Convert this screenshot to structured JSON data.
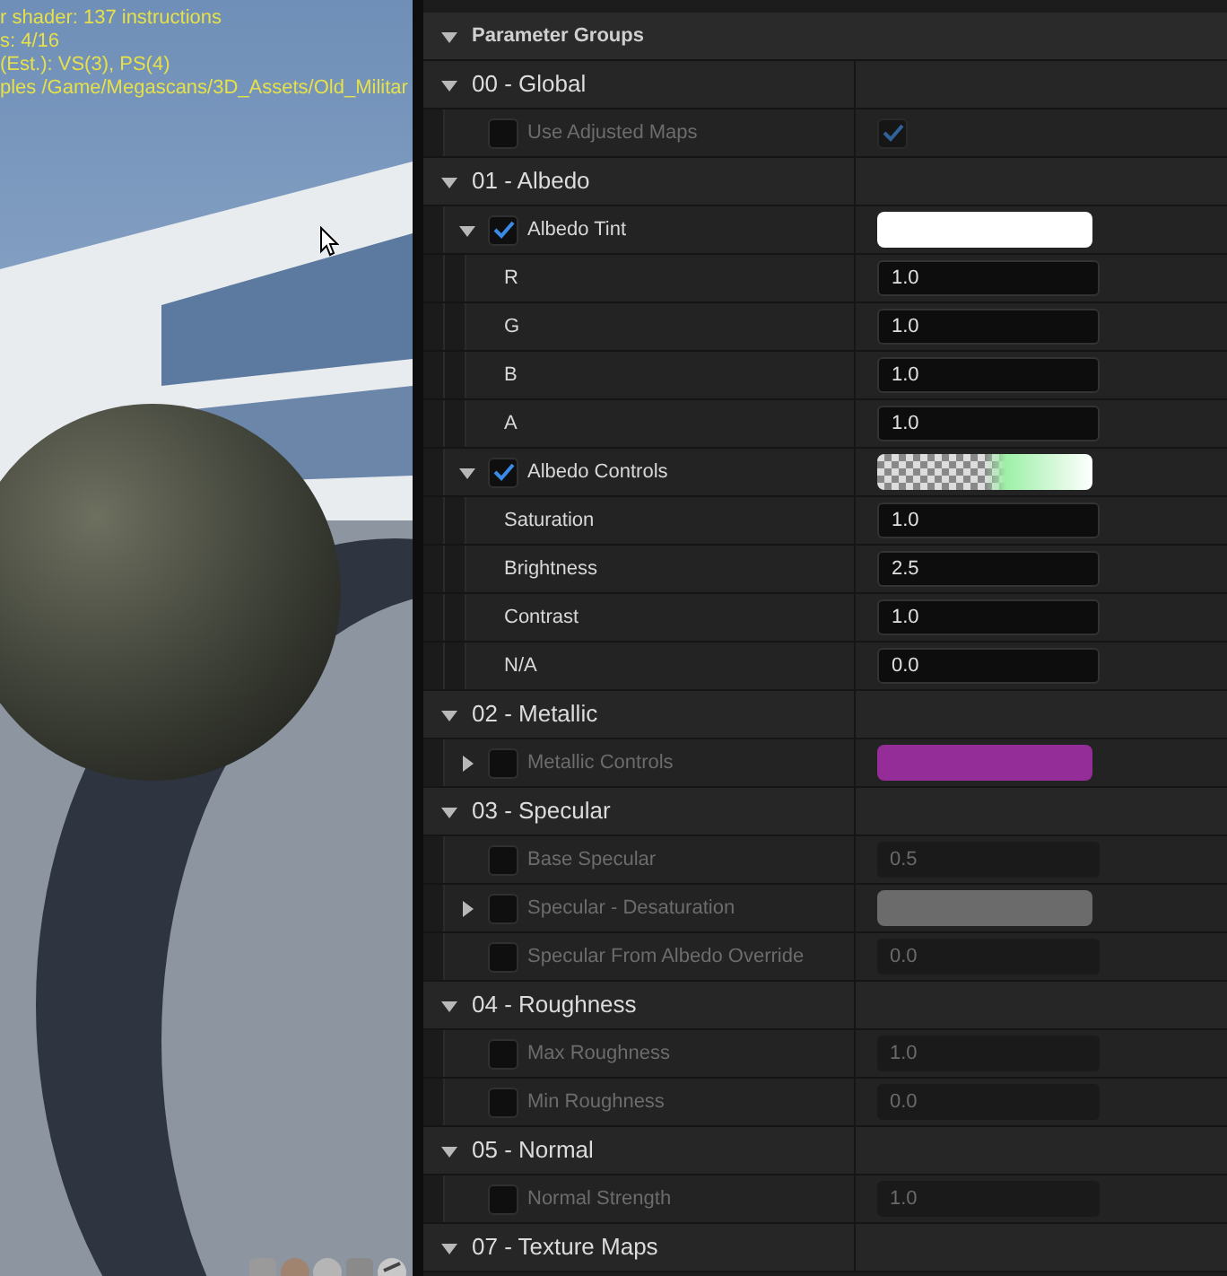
{
  "viewport": {
    "stats": [
      "r shader: 137 instructions",
      "s: 4/16",
      "(Est.): VS(3), PS(4)",
      "ples /Game/Megascans/3D_Assets/Old_Militar"
    ]
  },
  "details": {
    "title": "Parameter Groups",
    "expanded": true,
    "groups": [
      {
        "title": "00 - Global",
        "expanded": true,
        "params": [
          {
            "kind": "bool",
            "label": "Use Adjusted Maps",
            "enabled": false,
            "checked": true
          }
        ]
      },
      {
        "title": "01 - Albedo",
        "expanded": true,
        "params": [
          {
            "kind": "color",
            "label": "Albedo Tint",
            "enabled": true,
            "expanded": true,
            "color": "#ffffff",
            "children": [
              {
                "kind": "scalar",
                "label": "R",
                "value": "1.0"
              },
              {
                "kind": "scalar",
                "label": "G",
                "value": "1.0"
              },
              {
                "kind": "scalar",
                "label": "B",
                "value": "1.0"
              },
              {
                "kind": "scalar",
                "label": "A",
                "value": "1.0"
              }
            ]
          },
          {
            "kind": "gradient",
            "label": "Albedo Controls",
            "enabled": true,
            "expanded": true,
            "color": "#9ef0a8",
            "children": [
              {
                "kind": "scalar",
                "label": "Saturation",
                "value": "1.0"
              },
              {
                "kind": "scalar",
                "label": "Brightness",
                "value": "2.5"
              },
              {
                "kind": "scalar",
                "label": "Contrast",
                "value": "1.0"
              },
              {
                "kind": "scalar",
                "label": "N/A",
                "value": "0.0"
              }
            ]
          }
        ]
      },
      {
        "title": "02 - Metallic",
        "expanded": true,
        "params": [
          {
            "kind": "color",
            "label": "Metallic Controls",
            "enabled": false,
            "expanded": false,
            "color": "#952d98"
          }
        ]
      },
      {
        "title": "03 - Specular",
        "expanded": true,
        "params": [
          {
            "kind": "scalar",
            "label": "Base Specular",
            "enabled": false,
            "value": "0.5"
          },
          {
            "kind": "color",
            "label": "Specular - Desaturation",
            "enabled": false,
            "expanded": false,
            "color": "#6b6b6b"
          },
          {
            "kind": "scalar",
            "label": "Specular From Albedo Override",
            "enabled": false,
            "value": "0.0"
          }
        ]
      },
      {
        "title": "04 - Roughness",
        "expanded": true,
        "params": [
          {
            "kind": "scalar",
            "label": "Max Roughness",
            "enabled": false,
            "value": "1.0"
          },
          {
            "kind": "scalar",
            "label": "Min Roughness",
            "enabled": false,
            "value": "0.0"
          }
        ]
      },
      {
        "title": "05 - Normal",
        "expanded": true,
        "params": [
          {
            "kind": "scalar",
            "label": "Normal Strength",
            "enabled": false,
            "value": "1.0"
          }
        ]
      },
      {
        "title": "07 - Texture Maps",
        "expanded": true
      }
    ]
  }
}
